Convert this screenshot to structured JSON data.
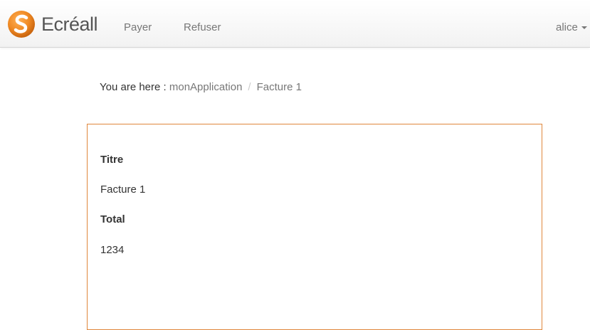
{
  "navbar": {
    "brand_name": "Ecréall",
    "links": [
      {
        "label": "Payer"
      },
      {
        "label": "Refuser"
      }
    ],
    "user": "alice"
  },
  "breadcrumb": {
    "prefix": "You are here :",
    "items": [
      {
        "label": "monApplication"
      },
      {
        "label": "Facture 1"
      }
    ],
    "separator": "/"
  },
  "detail": {
    "fields": [
      {
        "label": "Titre",
        "value": "Facture 1"
      },
      {
        "label": "Total",
        "value": "1234"
      }
    ]
  },
  "colors": {
    "accent": "#e0873c",
    "logo_orange": "#f08a24"
  }
}
